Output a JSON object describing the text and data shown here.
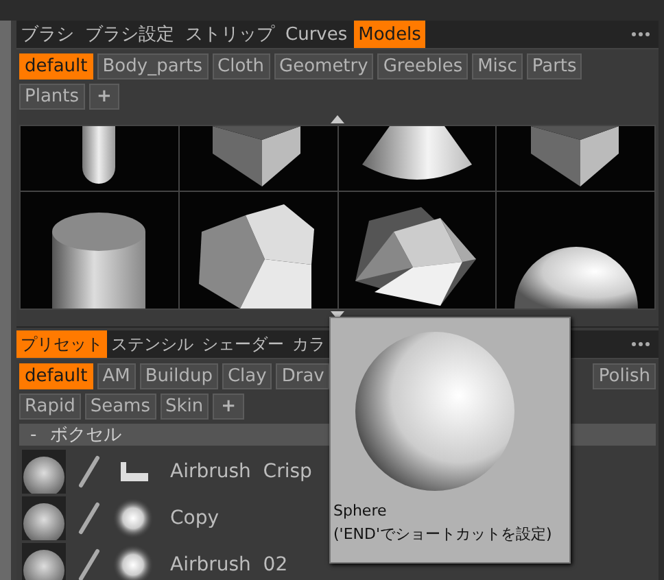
{
  "upper_panel": {
    "tabs": [
      {
        "label": "ブラシ",
        "selected": false
      },
      {
        "label": "ブラシ設定",
        "selected": false
      },
      {
        "label": "ストリップ",
        "selected": false
      },
      {
        "label": "Curves",
        "selected": false
      },
      {
        "label": "Models",
        "selected": true
      }
    ],
    "chip_rows": [
      {
        "chips": [
          {
            "label": "default",
            "selected": true
          },
          {
            "label": "Body_parts",
            "selected": false
          },
          {
            "label": "Cloth",
            "selected": false
          },
          {
            "label": "Geometry",
            "selected": false
          },
          {
            "label": "Greebles",
            "selected": false
          },
          {
            "label": "Misc",
            "selected": false
          },
          {
            "label": "Parts",
            "selected": false
          }
        ],
        "trailing": []
      },
      {
        "chips": [
          {
            "label": "Plants",
            "selected": false
          }
        ],
        "trailing": []
      }
    ],
    "add_label": "+"
  },
  "lower_panel": {
    "tabs": [
      {
        "label": "プリセット",
        "selected": true
      },
      {
        "label": "ステンシル",
        "selected": false
      },
      {
        "label": "シェーダー",
        "selected": false
      },
      {
        "label": "カラ",
        "selected": false
      }
    ],
    "chip_rows": [
      {
        "chips": [
          {
            "label": "default",
            "selected": true
          },
          {
            "label": "AM",
            "selected": false
          },
          {
            "label": "Buildup",
            "selected": false
          },
          {
            "label": "Clay",
            "selected": false
          },
          {
            "label": "Drav",
            "selected": false
          }
        ],
        "trailing": [
          {
            "label": "Polish",
            "selected": false
          }
        ]
      },
      {
        "chips": [
          {
            "label": "Rapid",
            "selected": false
          },
          {
            "label": "Seams",
            "selected": false
          },
          {
            "label": "Skin",
            "selected": false
          }
        ],
        "trailing": []
      }
    ],
    "add_label": "+",
    "group": {
      "toggle": "-",
      "title": "ボクセル",
      "expanded": true
    },
    "brushes": [
      {
        "name": "Airbrush  Crisp"
      },
      {
        "name": "Copy"
      },
      {
        "name": "Airbrush  02"
      }
    ]
  },
  "tooltip": {
    "title": "Sphere",
    "hint": "('END'でショートカットを設定)"
  }
}
